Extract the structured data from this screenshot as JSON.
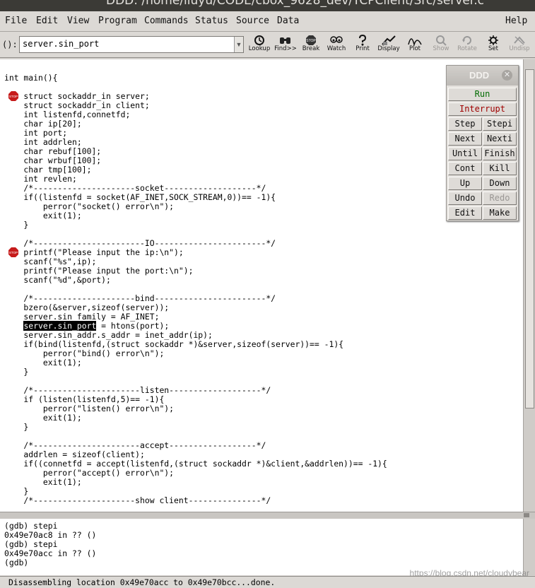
{
  "window": {
    "title": "DDD: /home/liuyu/CODE/cbox_9628_dev/TCPClient/Src/server.c"
  },
  "menubar": {
    "items": [
      "File",
      "Edit",
      "View",
      "Program",
      "Commands",
      "Status",
      "Source",
      "Data"
    ],
    "help": "Help"
  },
  "toolbar": {
    "arg_label": "():",
    "arg_value": "server.sin_port",
    "tools": [
      {
        "label": "Lookup",
        "icon": "lookup-icon",
        "enabled": true
      },
      {
        "label": "Find>>",
        "icon": "find-icon",
        "enabled": true
      },
      {
        "label": "Break",
        "icon": "break-icon",
        "enabled": true
      },
      {
        "label": "Watch",
        "icon": "watch-icon",
        "enabled": true
      },
      {
        "label": "Print",
        "icon": "print-icon",
        "enabled": true
      },
      {
        "label": "Display",
        "icon": "display-icon",
        "enabled": true
      },
      {
        "label": "Plot",
        "icon": "plot-icon",
        "enabled": true
      },
      {
        "label": "Show",
        "icon": "show-icon",
        "enabled": false
      },
      {
        "label": "Rotate",
        "icon": "rotate-icon",
        "enabled": false
      },
      {
        "label": "Set",
        "icon": "set-icon",
        "enabled": true
      },
      {
        "label": "Undisp",
        "icon": "undisp-icon",
        "enabled": false
      }
    ]
  },
  "source": {
    "lines": [
      {
        "text": "int main(){",
        "stop": false
      },
      {
        "text": "",
        "stop": false
      },
      {
        "text": "    struct sockaddr_in server;",
        "stop": true
      },
      {
        "text": "    struct sockaddr_in client;",
        "stop": false
      },
      {
        "text": "    int listenfd,connetfd;",
        "stop": false
      },
      {
        "text": "    char ip[20];",
        "stop": false
      },
      {
        "text": "    int port;",
        "stop": false
      },
      {
        "text": "    int addrlen;",
        "stop": false
      },
      {
        "text": "    char rebuf[100];",
        "stop": false
      },
      {
        "text": "    char wrbuf[100];",
        "stop": false
      },
      {
        "text": "    char tmp[100];",
        "stop": false
      },
      {
        "text": "    int revlen;",
        "stop": false
      },
      {
        "text": "    /*---------------------socket-------------------*/",
        "stop": false
      },
      {
        "text": "    if((listenfd = socket(AF_INET,SOCK_STREAM,0))== -1){",
        "stop": false
      },
      {
        "text": "        perror(\"socket() error\\n\");",
        "stop": false
      },
      {
        "text": "        exit(1);",
        "stop": false
      },
      {
        "text": "    }",
        "stop": false
      },
      {
        "text": "",
        "stop": false
      },
      {
        "text": "    /*-----------------------IO-----------------------*/",
        "stop": false
      },
      {
        "text": "    printf(\"Please input the ip:\\n\");",
        "stop": true
      },
      {
        "text": "    scanf(\"%s\",ip);",
        "stop": false
      },
      {
        "text": "    printf(\"Please input the port:\\n\");",
        "stop": false
      },
      {
        "text": "    scanf(\"%d\",&port);",
        "stop": false
      },
      {
        "text": "",
        "stop": false
      },
      {
        "text": "    /*---------------------bind-----------------------*/",
        "stop": false
      },
      {
        "text": "    bzero(&server,sizeof(server));",
        "stop": false
      },
      {
        "text": "    server.sin_family = AF_INET;",
        "stop": false
      },
      {
        "text": "    server.sin_port = htons(port);",
        "stop": false,
        "highlight": "server.sin_port",
        "rest": " = htons(port);",
        "indent": "    "
      },
      {
        "text": "    server.sin_addr.s_addr = inet_addr(ip);",
        "stop": false
      },
      {
        "text": "    if(bind(listenfd,(struct sockaddr *)&server,sizeof(server))== -1){",
        "stop": false
      },
      {
        "text": "        perror(\"bind() error\\n\");",
        "stop": false
      },
      {
        "text": "        exit(1);",
        "stop": false
      },
      {
        "text": "    }",
        "stop": false
      },
      {
        "text": "",
        "stop": false
      },
      {
        "text": "    /*----------------------listen-------------------*/",
        "stop": false
      },
      {
        "text": "    if (listen(listenfd,5)== -1){",
        "stop": false
      },
      {
        "text": "        perror(\"listen() error\\n\");",
        "stop": false
      },
      {
        "text": "        exit(1);",
        "stop": false
      },
      {
        "text": "    }",
        "stop": false
      },
      {
        "text": "",
        "stop": false
      },
      {
        "text": "    /*----------------------accept------------------*/",
        "stop": false
      },
      {
        "text": "    addrlen = sizeof(client);",
        "stop": false
      },
      {
        "text": "    if((connetfd = accept(listenfd,(struct sockaddr *)&client,&addrlen))== -1){",
        "stop": false
      },
      {
        "text": "        perror(\"accept() error\\n\");",
        "stop": false
      },
      {
        "text": "        exit(1);",
        "stop": false
      },
      {
        "text": "    }",
        "stop": false
      },
      {
        "text": "    /*---------------------show client---------------*/",
        "stop": false
      }
    ]
  },
  "console": {
    "lines": [
      "(gdb) stepi",
      "0x49e70ac8 in ?? ()",
      "(gdb) stepi",
      "0x49e70acc in ?? ()",
      "(gdb)"
    ]
  },
  "status": {
    "text": "Disassembling location 0x49e70acc to 0x49e70bcc...done."
  },
  "watermark": "https://blog.csdn.net/cloudybear",
  "command_tool": {
    "title": "DDD",
    "buttons": [
      {
        "label": "Run",
        "style": "run",
        "full": true
      },
      {
        "label": "Interrupt",
        "style": "interrupt",
        "full": true
      },
      {
        "label": "Step"
      },
      {
        "label": "Stepi"
      },
      {
        "label": "Next"
      },
      {
        "label": "Nexti"
      },
      {
        "label": "Until"
      },
      {
        "label": "Finish"
      },
      {
        "label": "Cont"
      },
      {
        "label": "Kill"
      },
      {
        "label": "Up"
      },
      {
        "label": "Down"
      },
      {
        "label": "Undo"
      },
      {
        "label": "Redo",
        "disabled": true
      },
      {
        "label": "Edit"
      },
      {
        "label": "Make"
      }
    ]
  },
  "colors": {
    "stop_sign": "#c61b1b",
    "run": "#006b00",
    "interrupt": "#a00000"
  }
}
